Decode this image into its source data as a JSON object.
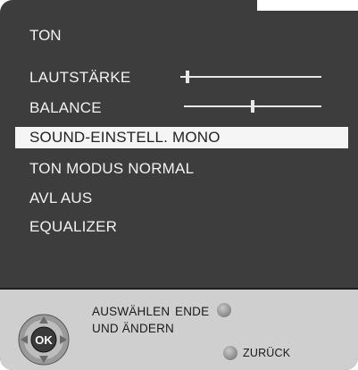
{
  "menu": {
    "title": "TON",
    "items": [
      {
        "label": "LAUTSTÄRKE",
        "slider": true,
        "value": 0.05
      },
      {
        "label": "BALANCE",
        "slider": true,
        "value": 0.5
      },
      {
        "label": "SOUND-EINSTELL. MONO",
        "selected": true
      },
      {
        "label": "TON MODUS NORMAL"
      },
      {
        "label": "AVL AUS"
      },
      {
        "label": "EQUALIZER"
      }
    ]
  },
  "footer": {
    "ok_label": "OK",
    "select_line1": "AUSWÄHLEN",
    "select_line2": "UND ÄNDERN",
    "end_label": "ENDE",
    "back_label": "ZURÜCK"
  },
  "colors": {
    "background": "#3d3d3d",
    "highlight": "#f5f5f5",
    "footer": "#cfcfcf"
  }
}
